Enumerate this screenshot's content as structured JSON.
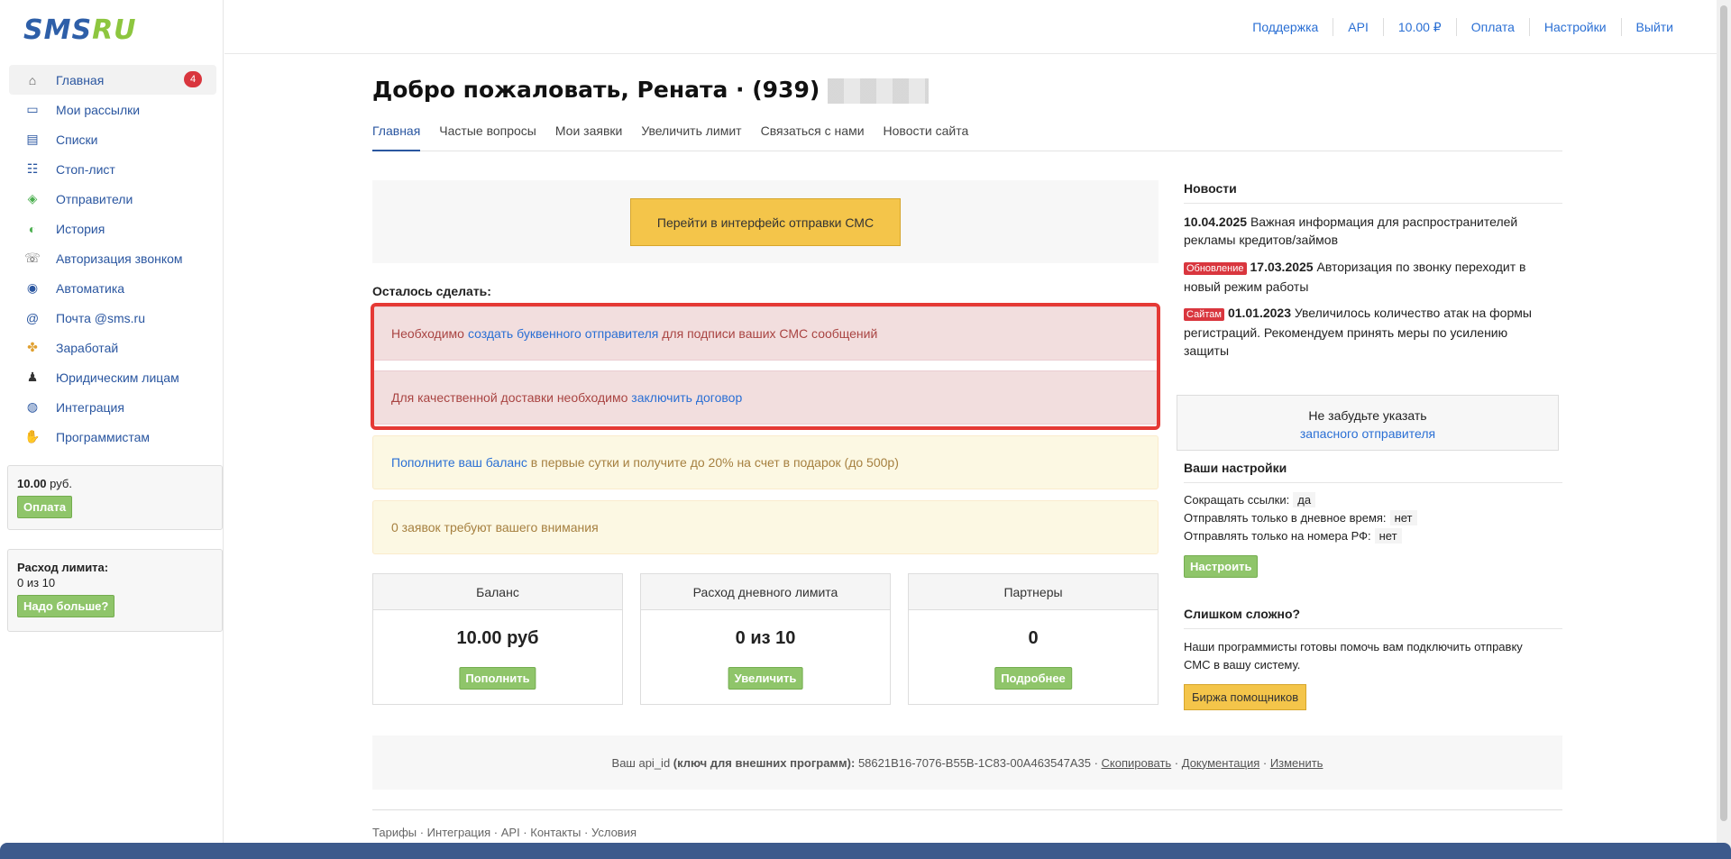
{
  "logo": {
    "part1": "SMS",
    "part2": "RU"
  },
  "sidebar": {
    "items": [
      {
        "label": "Главная",
        "icon": "home-icon",
        "badge": "4"
      },
      {
        "label": "Мои рассылки",
        "icon": "mailings-icon"
      },
      {
        "label": "Списки",
        "icon": "lists-icon"
      },
      {
        "label": "Стоп-лист",
        "icon": "stop-list-icon"
      },
      {
        "label": "Отправители",
        "icon": "tag-icon"
      },
      {
        "label": "История",
        "icon": "history-icon"
      },
      {
        "label": "Авторизация звонком",
        "icon": "phone-icon"
      },
      {
        "label": "Автоматика",
        "icon": "robot-icon"
      },
      {
        "label": "Почта @sms.ru",
        "icon": "at-icon"
      },
      {
        "label": "Заработай",
        "icon": "handshake-icon"
      },
      {
        "label": "Юридическим лицам",
        "icon": "person-icon"
      },
      {
        "label": "Интеграция",
        "icon": "integration-icon"
      },
      {
        "label": "Программистам",
        "icon": "hand-icon"
      }
    ],
    "balance": {
      "amount": "10.00",
      "unit": "руб.",
      "button": "Оплата"
    },
    "limit": {
      "title": "Расход лимита:",
      "value": "0 из 10",
      "button": "Надо больше?"
    }
  },
  "topnav": [
    "Поддержка",
    "API",
    "10.00 ₽",
    "Оплата",
    "Настройки",
    "Выйти"
  ],
  "header": {
    "title": "Добро пожаловать, Рената · (939)"
  },
  "tabs": [
    "Главная",
    "Частые вопросы",
    "Мои заявки",
    "Увеличить лимит",
    "Связаться с нами",
    "Новости сайта"
  ],
  "cta": {
    "label": "Перейти в интерфейс отправки СМС"
  },
  "todo": {
    "label": "Осталось сделать:",
    "alert1": {
      "pre": "Необходимо ",
      "link": "создать буквенного отправителя",
      "post": " для подписи ваших СМС сообщений"
    },
    "alert2": {
      "pre": "Для качественной доставки необходимо ",
      "link": "заключить договор"
    },
    "alert3": {
      "link": "Пополните ваш баланс",
      "post": " в первые сутки и получите до 20% на счет в подарок (до 500р)"
    },
    "alert4": {
      "text": "0 заявок требуют вашего внимания"
    }
  },
  "stats": [
    {
      "title": "Баланс",
      "value": "10.00 руб",
      "button": "Пополнить"
    },
    {
      "title": "Расход дневного лимита",
      "value": "0 из 10",
      "button": "Увеличить"
    },
    {
      "title": "Партнеры",
      "value": "0",
      "button": "Подробнее"
    }
  ],
  "api": {
    "pre": "Ваш api_id ",
    "bold": "(ключ для внешних программ):",
    "key": " 58621B16-7076-B55B-1C83-00A463547A35 · ",
    "copy": "Скопировать",
    "sep1": " · ",
    "docs": "Документация",
    "sep2": " · ",
    "change": "Изменить"
  },
  "footer": "Тарифы · Интеграция · API · Контакты · Условия",
  "news": {
    "title": "Новости",
    "items": [
      {
        "date": "10.04.2025",
        "tag": "",
        "text": " Важная информация для распространителей рекламы кредитов/займов"
      },
      {
        "date": "17.03.2025",
        "tag": "Обновление",
        "text": " Авторизация по звонку переходит в новый режим работы"
      },
      {
        "date": "01.01.2023",
        "tag": "Сайтам",
        "text": " Увеличилось количество атак на формы регистраций. Рекомендуем принять меры по усилению защиты"
      }
    ]
  },
  "reminder": {
    "line1": "Не забудьте указать",
    "link": "запасного отправителя"
  },
  "settings": {
    "title": "Ваши настройки",
    "rows": [
      {
        "label": "Сокращать ссылки:",
        "value": "да"
      },
      {
        "label": "Отправлять только в дневное время:",
        "value": "нет"
      },
      {
        "label": "Отправлять только на номера РФ:",
        "value": "нет"
      }
    ],
    "button": "Настроить"
  },
  "help": {
    "title": "Слишком сложно?",
    "text": "Наши программисты готовы помочь вам подключить отправку СМС в вашу систему.",
    "button": "Биржа помощников"
  },
  "colors": {
    "brand_blue": "#2e5fa8",
    "brand_green": "#8dc63f",
    "alert_red": "#e53935",
    "button_yellow": "#f4c54a",
    "button_green": "#8fc56a"
  }
}
